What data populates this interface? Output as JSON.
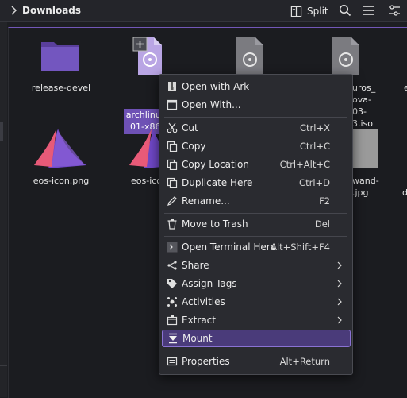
{
  "toolbar": {
    "title": "Downloads",
    "split_label": "Split"
  },
  "files": [
    {
      "name": "release-devel",
      "kind": "folder"
    },
    {
      "name_line1": "archlinux-",
      "name_line2": "01-x86_",
      "kind": "disc-image",
      "selected": true
    },
    {
      "name": "",
      "kind": "disc-image"
    },
    {
      "name_line1": "uros_",
      "name_line2": "ova-03-",
      "name_line3": "3.iso",
      "kind": "disc-image"
    },
    {
      "name": "eos-icon.png",
      "kind": "image"
    },
    {
      "name": "eos-ico",
      "kind": "image"
    },
    {
      "name_line1": "wand-",
      "name_line2": ".jpg",
      "kind": "image"
    },
    {
      "name": "e",
      "kind": "partial"
    },
    {
      "name": "d",
      "kind": "partial"
    }
  ],
  "context_menu": {
    "items": [
      {
        "label": "Open with Ark",
        "shortcut": "",
        "icon": "ark-icon"
      },
      {
        "label": "Open With...",
        "shortcut": "",
        "icon": "open-with-icon"
      },
      {
        "label": "Cut",
        "shortcut": "Ctrl+X",
        "icon": "scissors-icon"
      },
      {
        "label": "Copy",
        "shortcut": "Ctrl+C",
        "icon": "copy-icon"
      },
      {
        "label": "Copy Location",
        "shortcut": "Ctrl+Alt+C",
        "icon": "copy-location-icon"
      },
      {
        "label": "Duplicate Here",
        "shortcut": "Ctrl+D",
        "icon": "duplicate-icon"
      },
      {
        "label": "Rename...",
        "shortcut": "F2",
        "icon": "pencil-icon"
      },
      {
        "label": "Move to Trash",
        "shortcut": "Del",
        "icon": "trash-icon"
      },
      {
        "label": "Open Terminal Here",
        "shortcut": "Alt+Shift+F4",
        "icon": "terminal-icon"
      },
      {
        "label": "Share",
        "shortcut": "",
        "icon": "share-icon",
        "submenu": true
      },
      {
        "label": "Assign Tags",
        "shortcut": "",
        "icon": "tag-icon",
        "submenu": true
      },
      {
        "label": "Activities",
        "shortcut": "",
        "icon": "activities-icon",
        "submenu": true
      },
      {
        "label": "Extract",
        "shortcut": "",
        "icon": "extract-icon",
        "submenu": true
      },
      {
        "label": "Mount",
        "shortcut": "",
        "icon": "mount-icon",
        "highlighted": true
      },
      {
        "label": "Properties",
        "shortcut": "Alt+Return",
        "icon": "properties-icon"
      }
    ]
  },
  "colors": {
    "accent": "#6e51b5",
    "highlight_border": "#8a72d4",
    "folder": "#6a4fb0",
    "disc_file": "#b7a3e2",
    "background": "#1b1c20"
  }
}
